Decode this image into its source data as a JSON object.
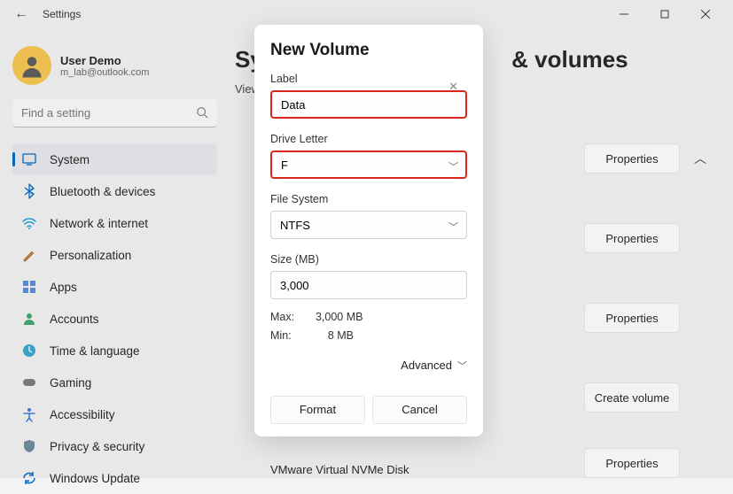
{
  "app": {
    "title": "Settings"
  },
  "user": {
    "name": "User Demo",
    "email": "m_lab@outlook.com"
  },
  "search": {
    "placeholder": "Find a setting"
  },
  "sidebar": {
    "items": [
      {
        "label": "System"
      },
      {
        "label": "Bluetooth & devices"
      },
      {
        "label": "Network & internet"
      },
      {
        "label": "Personalization"
      },
      {
        "label": "Apps"
      },
      {
        "label": "Accounts"
      },
      {
        "label": "Time & language"
      },
      {
        "label": "Gaming"
      },
      {
        "label": "Accessibility"
      },
      {
        "label": "Privacy & security"
      },
      {
        "label": "Windows Update"
      }
    ]
  },
  "page": {
    "title_prefix": "Sy",
    "title_suffix": "& volumes",
    "view": "View",
    "buttons": {
      "properties": "Properties",
      "create_volume": "Create volume"
    },
    "disk": "VMware Virtual NVMe Disk"
  },
  "modal": {
    "title": "New Volume",
    "label_lbl": "Label",
    "label_value": "Data",
    "drive_lbl": "Drive Letter",
    "drive_value": "F",
    "fs_lbl": "File System",
    "fs_value": "NTFS",
    "size_lbl": "Size (MB)",
    "size_value": "3,000",
    "max_key": "Max:",
    "max_val": "3,000 MB",
    "min_key": "Min:",
    "min_val": "8 MB",
    "advanced": "Advanced",
    "format": "Format",
    "cancel": "Cancel"
  }
}
